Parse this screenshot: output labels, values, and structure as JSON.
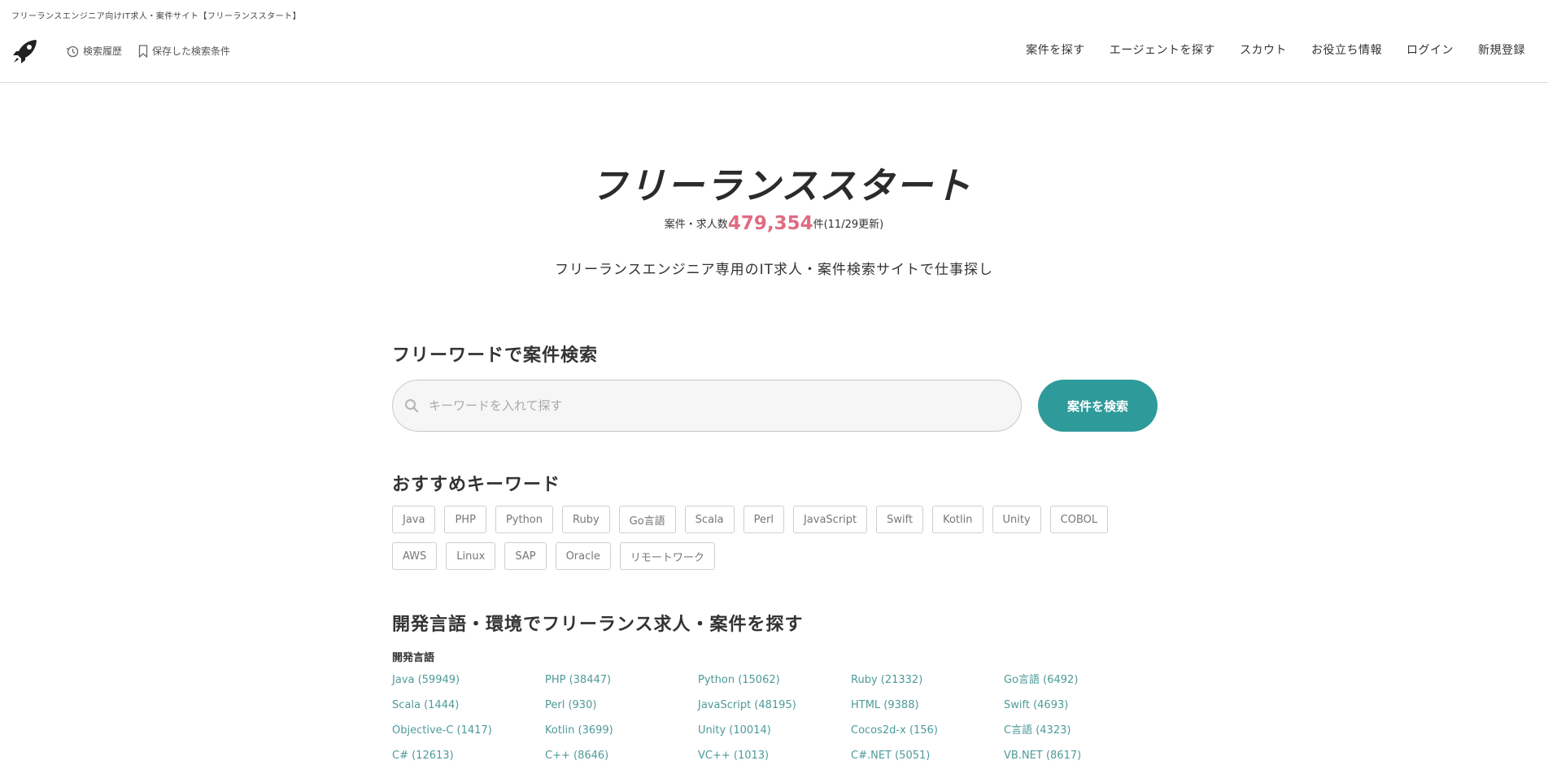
{
  "page_caption": "フリーランスエンジニア向けIT求人・案件サイト【フリーランススタート】",
  "header": {
    "history_label": "検索履歴",
    "saved_label": "保存した検索条件",
    "nav": [
      "案件を探す",
      "エージェントを探す",
      "スカウト",
      "お役立ち情報",
      "ログイン",
      "新規登録"
    ]
  },
  "hero": {
    "brand": "フリーランススタート",
    "count_prefix": "案件・求人数",
    "count": "479,354",
    "count_suffix": "件(11/29更新)",
    "tagline": "フリーランスエンジニア専用のIT求人・案件検索サイトで仕事探し"
  },
  "search": {
    "heading": "フリーワードで案件検索",
    "placeholder": "キーワードを入れて探す",
    "button": "案件を検索"
  },
  "keywords": {
    "heading": "おすすめキーワード",
    "items": [
      "Java",
      "PHP",
      "Python",
      "Ruby",
      "Go言語",
      "Scala",
      "Perl",
      "JavaScript",
      "Swift",
      "Kotlin",
      "Unity",
      "COBOL",
      "AWS",
      "Linux",
      "SAP",
      "Oracle",
      "リモートワーク"
    ]
  },
  "languages": {
    "heading": "開発言語・環境でフリーランス求人・案件を探す",
    "sub_heading": "開発言語",
    "items": [
      "Java (59949)",
      "PHP (38447)",
      "Python (15062)",
      "Ruby (21332)",
      "Go言語 (6492)",
      "Scala (1444)",
      "Perl (930)",
      "JavaScript (48195)",
      "HTML (9388)",
      "Swift (4693)",
      "Objective-C (1417)",
      "Kotlin (3699)",
      "Unity (10014)",
      "Cocos2d-x (156)",
      "C言語 (4323)",
      "C# (12613)",
      "C++ (8646)",
      "VC++ (1013)",
      "C#.NET (5051)",
      "VB.NET (8617)"
    ]
  },
  "colors": {
    "accent": "#2e9a9a",
    "count": "#e06b82",
    "link": "#4e9a9a"
  }
}
